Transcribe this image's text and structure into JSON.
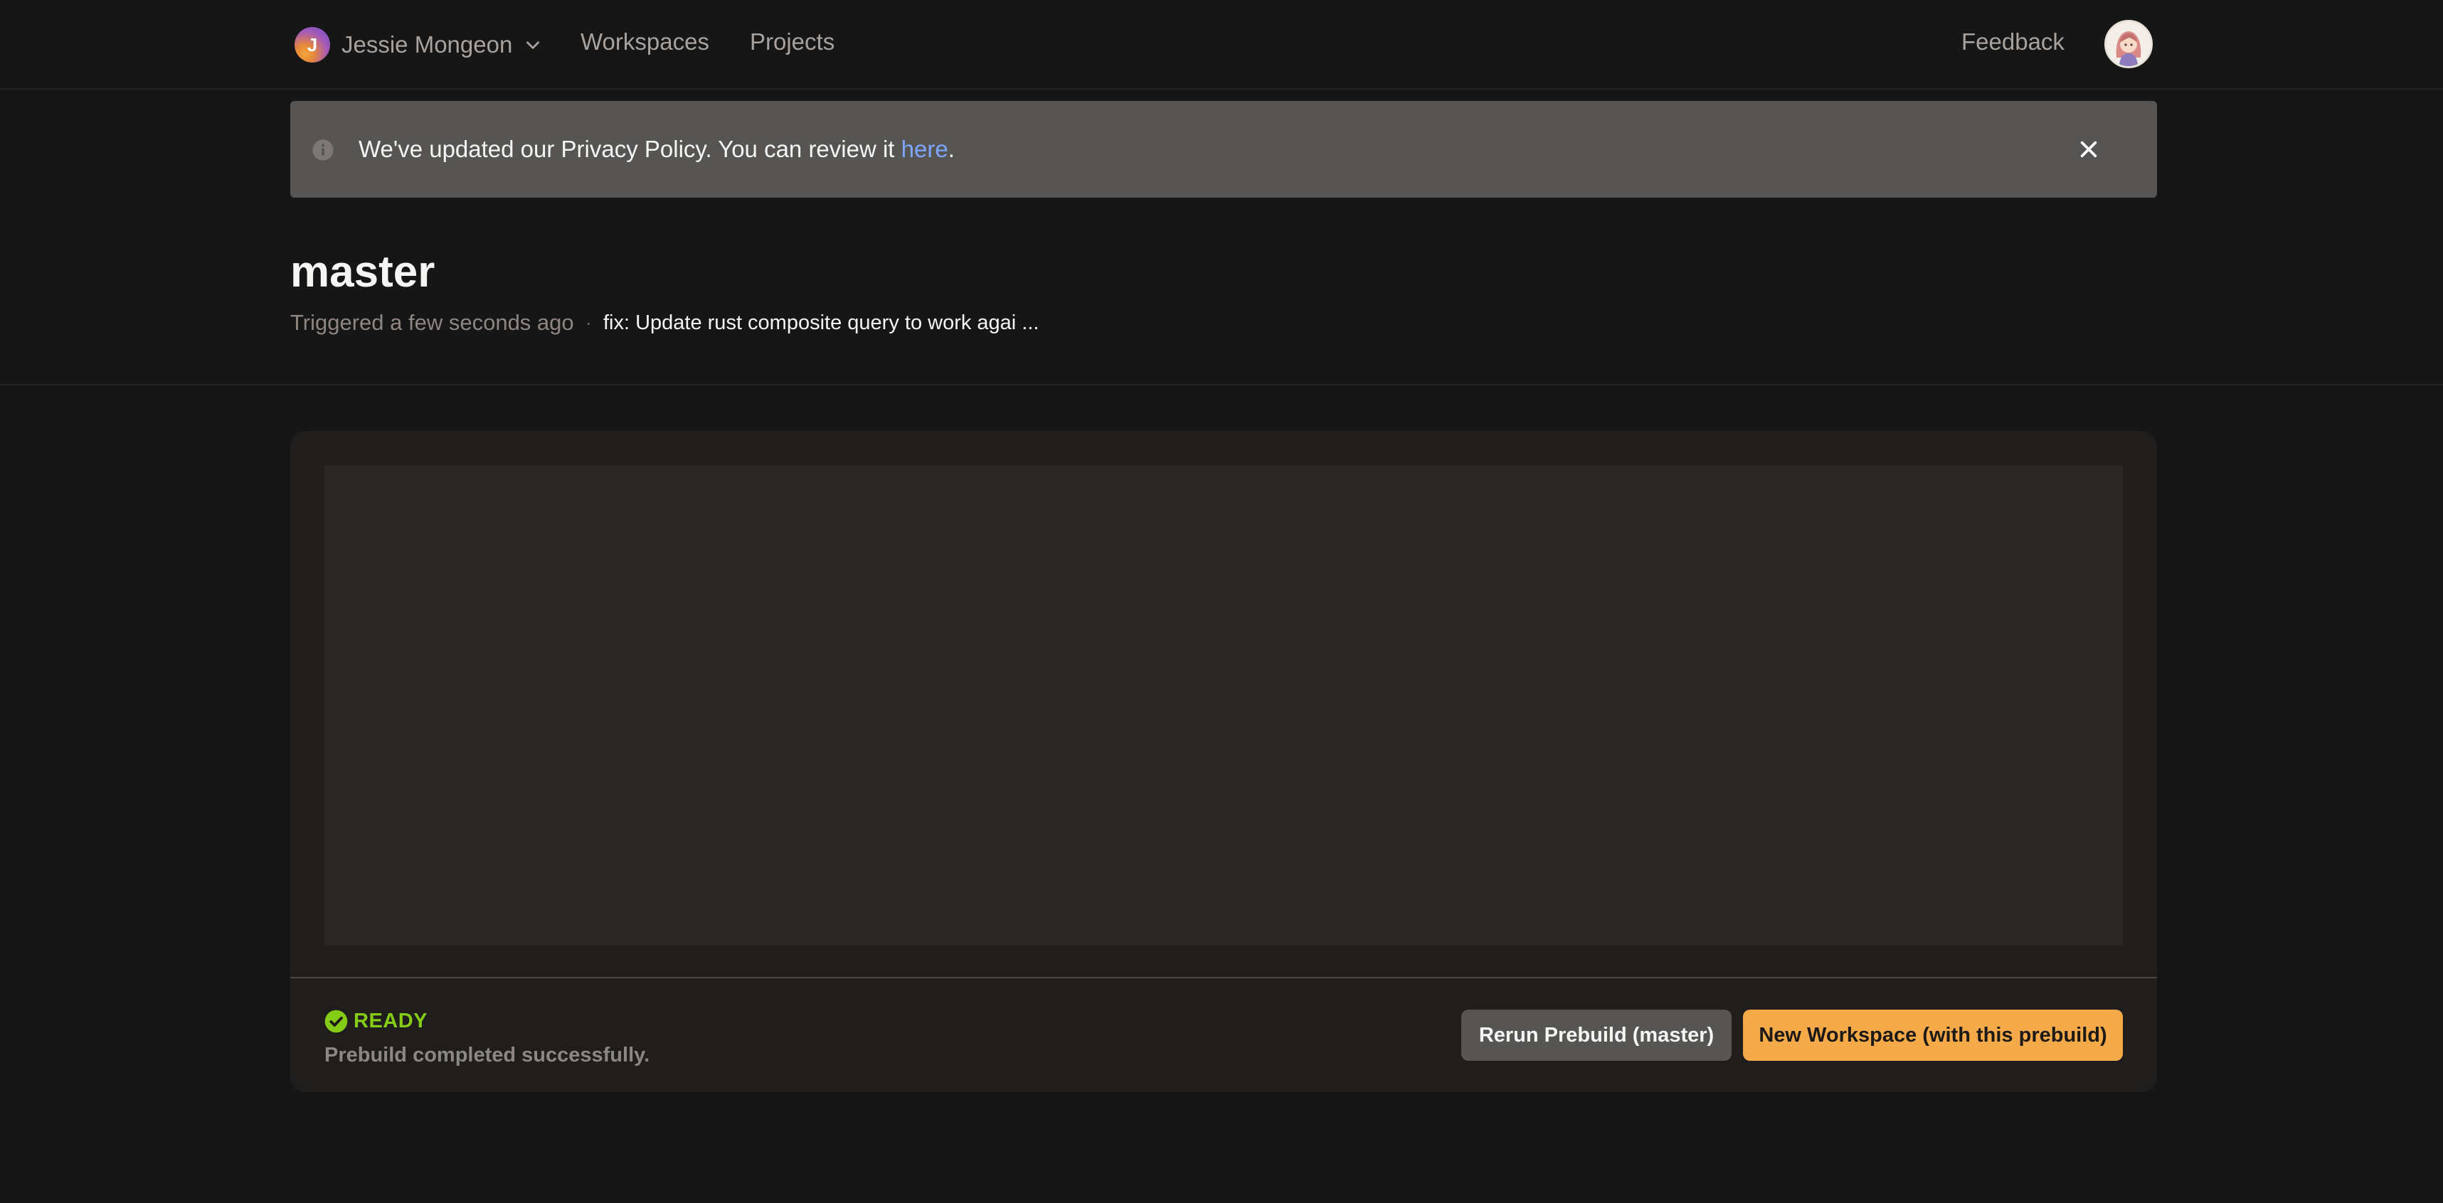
{
  "nav": {
    "org_initial": "J",
    "org_name": "Jessie Mongeon",
    "links": [
      "Workspaces",
      "Projects"
    ],
    "feedback": "Feedback",
    "icons": {
      "org_dropdown": "chevron-down-icon",
      "user_avatar": "avatar"
    }
  },
  "banner": {
    "text_before": "We've updated our Privacy Policy. You can review it ",
    "link_text": "here",
    "text_after": ".",
    "icons": {
      "info": "info-icon",
      "close": "close-icon"
    }
  },
  "header": {
    "title": "master",
    "triggered": "Triggered a few seconds ago",
    "separator": "·",
    "commit_message": "fix: Update rust composite query to work agai ..."
  },
  "prebuild": {
    "status_label": "READY",
    "status_description": "Prebuild completed successfully.",
    "status_color": "#84cc16",
    "rerun_button": "Rerun Prebuild (master)",
    "new_workspace_button": "New Workspace (with this prebuild)",
    "accent_color": "#f5aa4a"
  }
}
